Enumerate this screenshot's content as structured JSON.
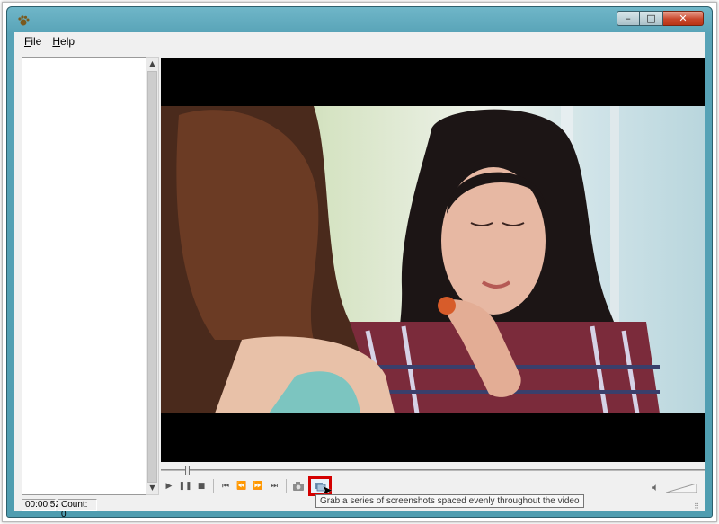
{
  "window": {
    "minimize_glyph": "–",
    "maximize_glyph": "□",
    "close_glyph": "✕"
  },
  "menu": {
    "file": "ile",
    "file_accel": "F",
    "help": "elp",
    "help_accel": "H"
  },
  "player": {
    "position_fraction": 0.045,
    "controls": [
      {
        "name": "play-icon",
        "glyph": "▶"
      },
      {
        "name": "pause-icon",
        "glyph": "❚❚"
      },
      {
        "name": "stop-icon",
        "glyph": "■"
      },
      {
        "name": "skip-start-icon",
        "glyph": "⏮"
      },
      {
        "name": "rewind-icon",
        "glyph": "⏪"
      },
      {
        "name": "fast-forward-icon",
        "glyph": "⏩"
      },
      {
        "name": "skip-end-icon",
        "glyph": "⏭"
      }
    ]
  },
  "tooltip": {
    "text": "Grab a series of screenshots spaced evenly throughout the video"
  },
  "status": {
    "time": "00:00:52",
    "count": "Count: 0"
  },
  "colors": {
    "highlight": "#d40000",
    "window_frame": "#58a3b7",
    "close_button": "#c9472c"
  }
}
